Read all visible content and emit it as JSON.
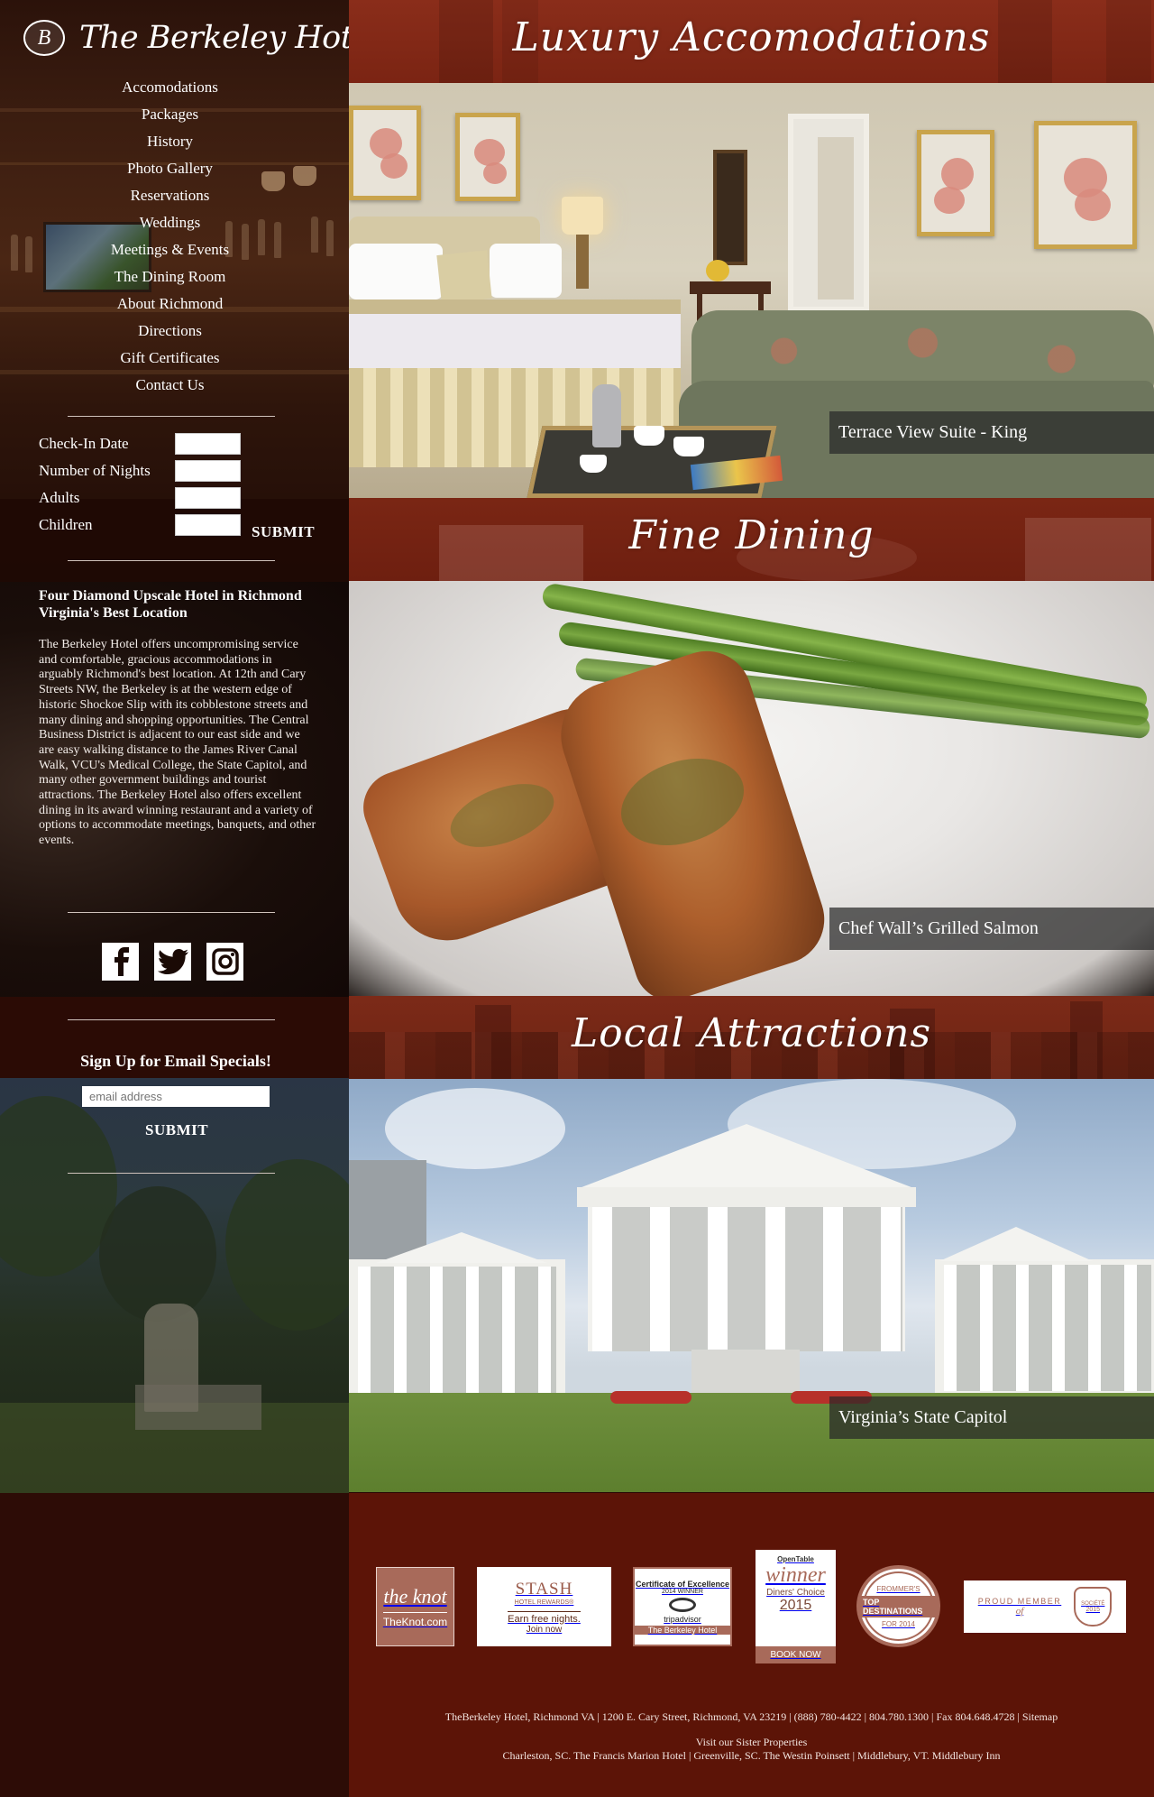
{
  "logo": {
    "badge_letter": "B",
    "name": "The Berkeley Hotel"
  },
  "nav": [
    "Accomodations",
    "Packages",
    "History",
    "Photo Gallery",
    "Reservations",
    "Weddings",
    "Meetings & Events",
    "The Dining Room",
    "About Richmond",
    "Directions",
    "Gift Certificates",
    "Contact Us"
  ],
  "booking": {
    "checkin_label": "Check-In Date",
    "nights_label": "Number of Nights",
    "adults_label": "Adults",
    "children_label": "Children",
    "submit_label": "SUBMIT"
  },
  "about": {
    "title": "Four Diamond Upscale Hotel in Richmond Virginia's Best Location",
    "body": "The Berkeley Hotel offers uncompromising service and comfortable, gracious accommodations in arguably Richmond's best location. At 12th and Cary Streets NW, the Berkeley is at the western edge of historic Shockoe Slip with its cobblestone streets and many dining and shopping opportunities. The Central Business District is adjacent to our east side and we are easy walking distance to the James River Canal Walk, VCU's Medical College, the State Capitol, and many other government buildings and tourist attractions. The Berkeley Hotel also offers excellent dining in its award winning restaurant and a variety of options to accommodate meetings, banquets, and other events."
  },
  "social": [
    "facebook-icon",
    "twitter-icon",
    "instagram-icon"
  ],
  "signup": {
    "title": "Sign Up for Email Specials!",
    "placeholder": "email address",
    "submit_label": "SUBMIT"
  },
  "sections": [
    {
      "heading": "Luxury Accomodations",
      "caption": "Terrace View Suite - King"
    },
    {
      "heading": "Fine Dining",
      "caption": "Chef Wall’s Grilled Salmon"
    },
    {
      "heading": "Local Attractions",
      "caption": "Virginia’s State Capitol"
    }
  ],
  "badges": {
    "knot": {
      "line1": "the knot",
      "line2": "TheKnot.com"
    },
    "stash": {
      "line1": "STASH",
      "line2": "HOTEL REWARDS®",
      "line3": "Earn free nights.",
      "line4": "Join now"
    },
    "tripadvisor": {
      "line1": "Certificate of Excellence",
      "line2": "2014 WINNER",
      "line3": "tripadvisor",
      "line4": "The Berkeley Hotel"
    },
    "opentable": {
      "line1": "OpenTable",
      "line2": "winner",
      "line3": "Diners' Choice",
      "line4": "2015",
      "line5": "BOOK NOW"
    },
    "frommers": {
      "line1": "FROMMER'S",
      "line2": "TOP DESTINATIONS",
      "line3": "FOR 2014"
    },
    "societe": {
      "line1": "PROUD MEMBER",
      "line2": "of",
      "line3": "SOCIÉTÉ",
      "line4": "2015"
    }
  },
  "footer": {
    "address": "TheBerkeley Hotel, Richmond VA | 1200 E. Cary Street, Richmond, VA 23219 | (888) 780-4422 | 804.780.1300 | Fax 804.648.4728 | Sitemap",
    "sister_title": "Visit our Sister Properties",
    "sister_list": "Charleston, SC. The Francis Marion Hotel | Greenville, SC. The Westin Poinsett | Middlebury, VT. Middlebury Inn"
  },
  "colors": {
    "brand_red": "#7a1d0e",
    "footer_red": "#5c1407",
    "dark_brown": "#2b0b05"
  }
}
